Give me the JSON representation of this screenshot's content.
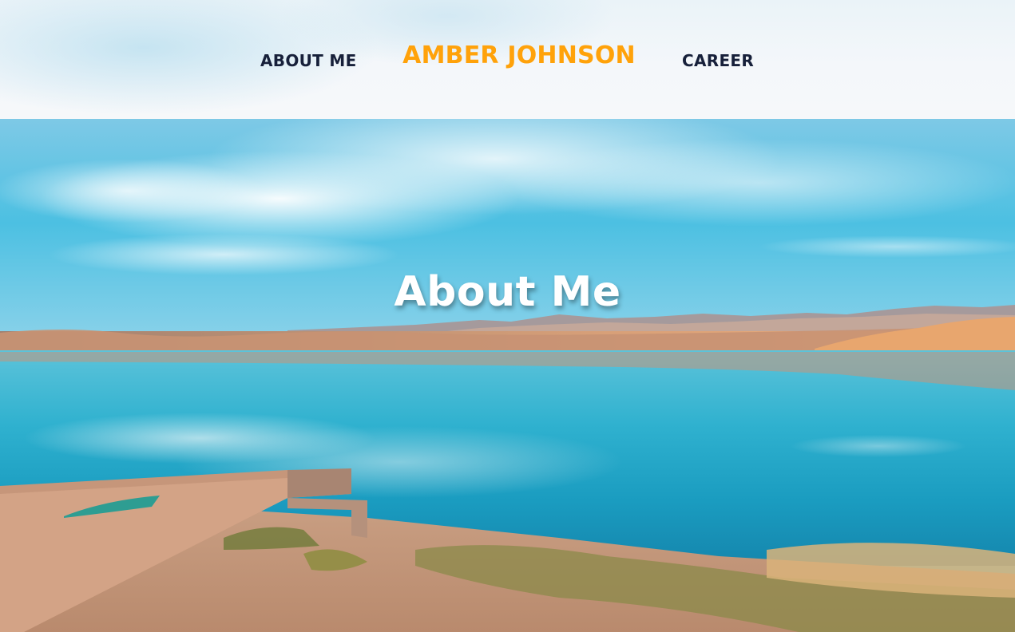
{
  "nav": {
    "about_label": "ABOUT ME",
    "brand_label": "AMBER JOHNSON",
    "career_label": "CAREER"
  },
  "hero": {
    "title": "About Me"
  },
  "colors": {
    "brand": "#ffa20a",
    "nav_text": "#17203a",
    "hero_title": "#ffffff"
  }
}
